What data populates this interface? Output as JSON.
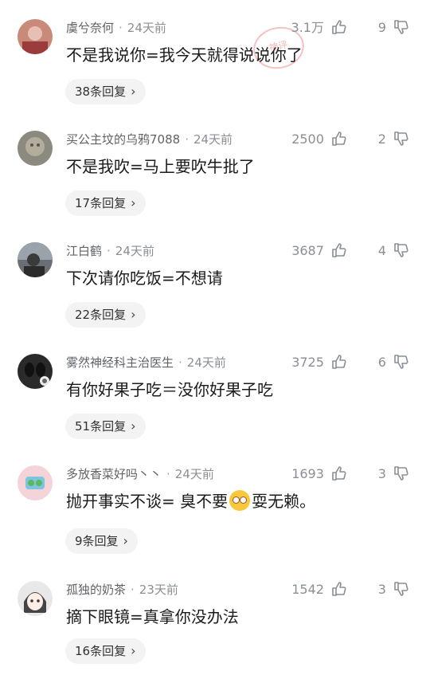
{
  "comments": [
    {
      "user": "虞兮奈何",
      "time": "24天前",
      "text": "不是我说你=我今天就得说说你了",
      "likes": "3.1万",
      "dislikes": "9",
      "replies": "38条回复",
      "avatar_color": "#c98a7a"
    },
    {
      "user": "买公主坟的乌鸦7088",
      "time": "24天前",
      "text": "不是我吹=马上要吹牛批了",
      "likes": "2500",
      "dislikes": "2",
      "replies": "17条回复",
      "avatar_color": "#8c8a7e"
    },
    {
      "user": "江白鹤",
      "time": "24天前",
      "text": "下次请你吃饭=不想请",
      "likes": "3687",
      "dislikes": "4",
      "replies": "22条回复",
      "avatar_color": "#6b6f75"
    },
    {
      "user": "雾然神经科主治医生",
      "time": "24天前",
      "text": "有你好果子吃＝没你好果子吃",
      "likes": "3725",
      "dislikes": "6",
      "replies": "51条回复",
      "avatar_color": "#2a2a2a"
    },
    {
      "user": "多放香菜好吗丶丶",
      "time": "24天前",
      "text_before": "抛开事实不谈= 臭不要",
      "text_after": "耍无赖。",
      "likes": "1693",
      "dislikes": "3",
      "replies": "9条回复",
      "avatar_color": "#f4d4d8"
    },
    {
      "user": "孤独的奶茶",
      "time": "23天前",
      "text": "摘下眼镜=真拿你没办法",
      "likes": "1542",
      "dislikes": "3",
      "replies": "16条回复",
      "avatar_color": "#e8e8e8"
    }
  ],
  "watermark": "神评"
}
